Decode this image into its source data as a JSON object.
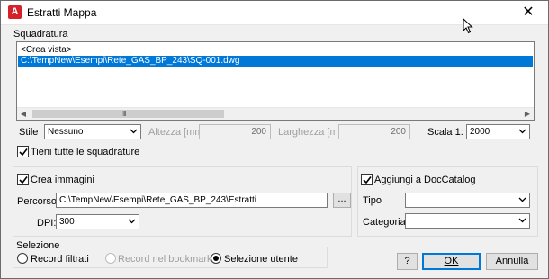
{
  "window": {
    "title": "Estratti Mappa",
    "app_icon_letter": "A",
    "close_glyph": "✕"
  },
  "squadratura": {
    "group_label": "Squadratura",
    "list_items": [
      "<Crea vista>",
      "C:\\TempNew\\Esempi\\Rete_GAS_BP_243\\SQ-001.dwg"
    ],
    "selected_index": 1,
    "scroll_left_glyph": "◀",
    "scroll_right_glyph": "▶",
    "thumb_grip": "III"
  },
  "options": {
    "stile_label": "Stile",
    "stile_value": "Nessuno",
    "altezza_label": "Altezza [mm]",
    "altezza_value": "200",
    "larghezza_label": "Larghezza [mm]",
    "larghezza_value": "200",
    "scala_label": "Scala 1:",
    "scala_value": "2000",
    "tieni_label": "Tieni tutte le squadrature",
    "tieni_checked": true
  },
  "immagini": {
    "crea_label": "Crea immagini",
    "crea_checked": true,
    "percorso_label": "Percorso:",
    "percorso_value": "C:\\TempNew\\Esempi\\Rete_GAS_BP_243\\Estratti",
    "browse_label": "...",
    "dpi_label": "DPI:",
    "dpi_value": "300"
  },
  "doccatalog": {
    "aggiungi_label": "Aggiungi a DocCatalog",
    "aggiungi_checked": true,
    "tipo_label": "Tipo",
    "tipo_value": "",
    "categoria_label": "Categoria",
    "categoria_value": ""
  },
  "selezione": {
    "group_label": "Selezione",
    "options": [
      "Record filtrati",
      "Record nel bookmark",
      "Selezione utente"
    ],
    "selected_index": 2
  },
  "buttons": {
    "help": "?",
    "ok": "OK",
    "cancel": "Annulla"
  },
  "icons": {
    "dropdown": "chevron-down-icon",
    "check": "check-icon",
    "cursor": "mouse-cursor-icon"
  }
}
